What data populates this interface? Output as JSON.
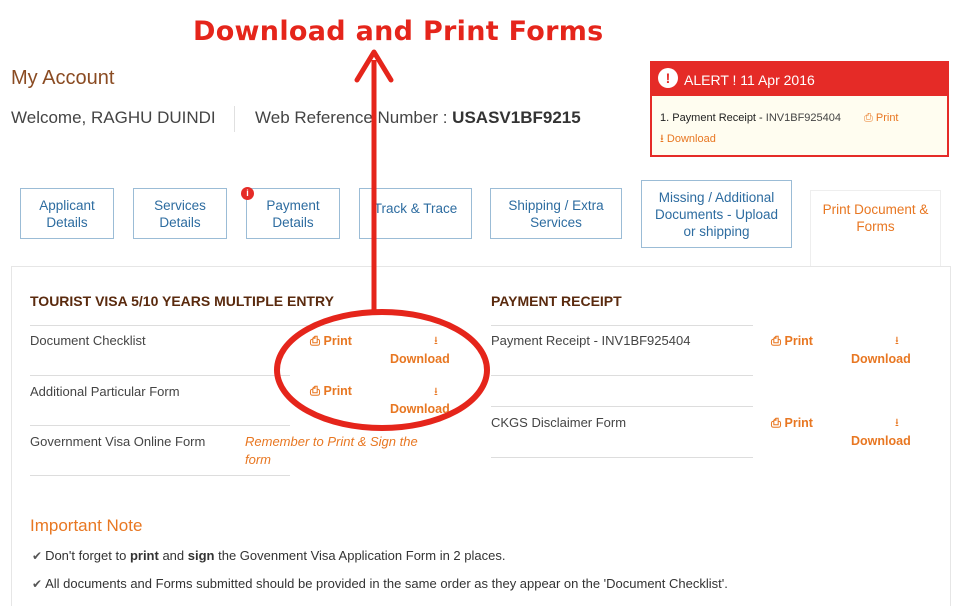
{
  "annotation": {
    "title": "Download and Print Forms",
    "color": "#e5251b"
  },
  "account": {
    "heading": "My Account",
    "welcome": "Welcome, RAGHU DUINDI",
    "webref_label": "Web Reference Number : ",
    "webref_value": "USASV1BF9215"
  },
  "alert": {
    "icon": "exclamation-icon",
    "title_prefix": "ALERT ! ",
    "date": "11 Apr 2016",
    "item_text": "1. Payment Receipt - ",
    "item_ref": "INV1BF925404",
    "print_label": "Print",
    "download_label": "Download"
  },
  "tabs": [
    {
      "label": "Applicant Details"
    },
    {
      "label": "Services Details"
    },
    {
      "label": "Payment Details",
      "badge": "i"
    },
    {
      "label": "Track & Trace"
    },
    {
      "label": "Shipping / Extra Services"
    },
    {
      "label": "Missing / Additional Documents - Upload or shipping"
    },
    {
      "label": "Print Document & Forms",
      "active": true
    }
  ],
  "visa_section": {
    "title": "TOURIST VISA 5/10 YEARS MULTIPLE ENTRY",
    "rows": [
      {
        "label": "Document Checklist",
        "print": "Print",
        "download": "Download"
      },
      {
        "label": "Additional Particular Form",
        "print": "Print",
        "download": "Download"
      },
      {
        "label": "Government Visa Online Form",
        "note": "Remember to Print & Sign the form"
      }
    ]
  },
  "receipt_section": {
    "title": "PAYMENT RECEIPT",
    "rows": [
      {
        "label": "Payment Receipt - INV1BF925404",
        "print": "Print",
        "download": "Download"
      },
      {
        "label": "CKGS Disclaimer Form",
        "print": "Print",
        "download": "Download"
      }
    ]
  },
  "important": {
    "title": "Important Note",
    "line1_a": "Don't forget to ",
    "line1_b": "print",
    "line1_c": " and ",
    "line1_d": "sign",
    "line1_e": " the Govenment Visa Application Form in 2 places.",
    "line2": "All documents and Forms submitted should be provided in the same order as they appear on the 'Document Checklist'."
  },
  "colors": {
    "accent": "#e87722",
    "alert": "#e52b27",
    "tab_border": "#9bbcd6",
    "tab_text": "#2d6ca0",
    "heading_brown": "#8a4b22"
  }
}
